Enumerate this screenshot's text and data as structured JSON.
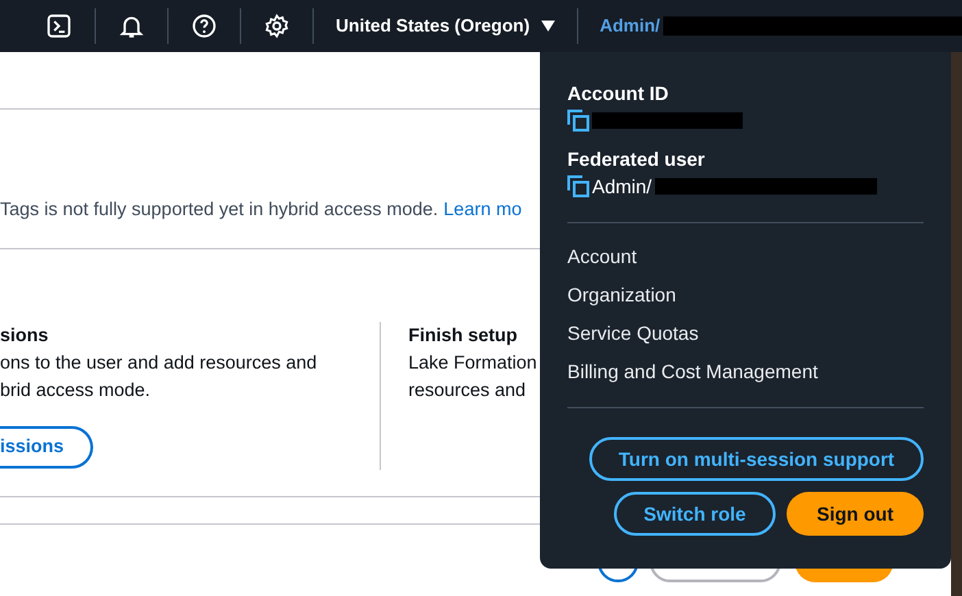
{
  "header": {
    "region": "United States (Oregon)",
    "user": "Admin/"
  },
  "notice": {
    "text": "Tags is not fully supported yet in hybrid access mode.",
    "link": "Learn mo"
  },
  "cards": [
    {
      "title": "sions",
      "lines": [
        "ons to the user and add resources and",
        "brid access mode."
      ],
      "button": "issions"
    },
    {
      "title": "Finish setup",
      "lines": [
        "Lake Formation",
        "resources and"
      ]
    }
  ],
  "account_menu": {
    "fields": [
      {
        "label": "Account ID"
      },
      {
        "label": "Federated user",
        "value": "Admin/"
      }
    ],
    "links": [
      "Account",
      "Organization",
      "Service Quotas",
      "Billing and Cost Management"
    ],
    "buttons": [
      {
        "label": "Turn on multi-session support",
        "kind": "outline"
      },
      {
        "label": "Switch role",
        "kind": "outline"
      },
      {
        "label": "Sign out",
        "kind": "primary"
      }
    ]
  }
}
